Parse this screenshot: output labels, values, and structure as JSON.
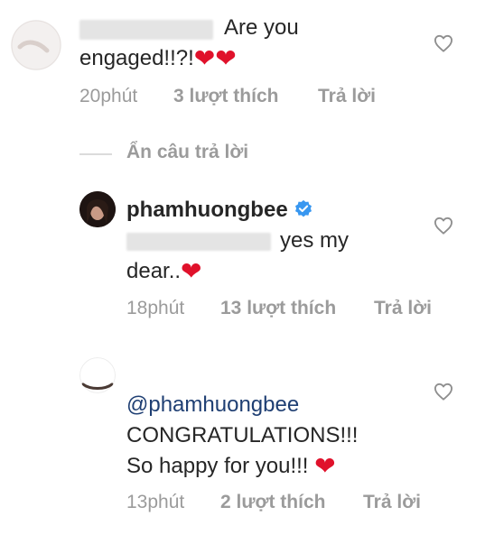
{
  "comment1": {
    "hidden_prefix": "...",
    "text_part1": "Are you",
    "text_part2": "engaged!!?!",
    "emoji": "❤❤",
    "time": "20phút",
    "likes": "3 lượt thích",
    "reply": "Trả lời"
  },
  "hide_replies": "Ẩn câu trả lời",
  "reply1": {
    "username": "phamhuongbee",
    "text_part1": "yes my",
    "text_part2": "dear..",
    "emoji": "❤",
    "time": "18phút",
    "likes": "13 lượt thích",
    "reply": "Trả lời"
  },
  "comment2": {
    "mention": "@phamhuongbee",
    "line1": "CONGRATULATIONS!!!",
    "line2": "So happy for you!!!",
    "emoji": "❤",
    "time": "13phút",
    "likes": "2 lượt thích",
    "reply": "Trả lời"
  },
  "icons": {
    "like": "heart-outline-icon",
    "verified": "verified-badge-icon"
  },
  "colors": {
    "heart_emoji": "#e0112b",
    "meta_text": "#9b9b9b",
    "verified": "#3897f0",
    "mention": "#1f3f73"
  }
}
